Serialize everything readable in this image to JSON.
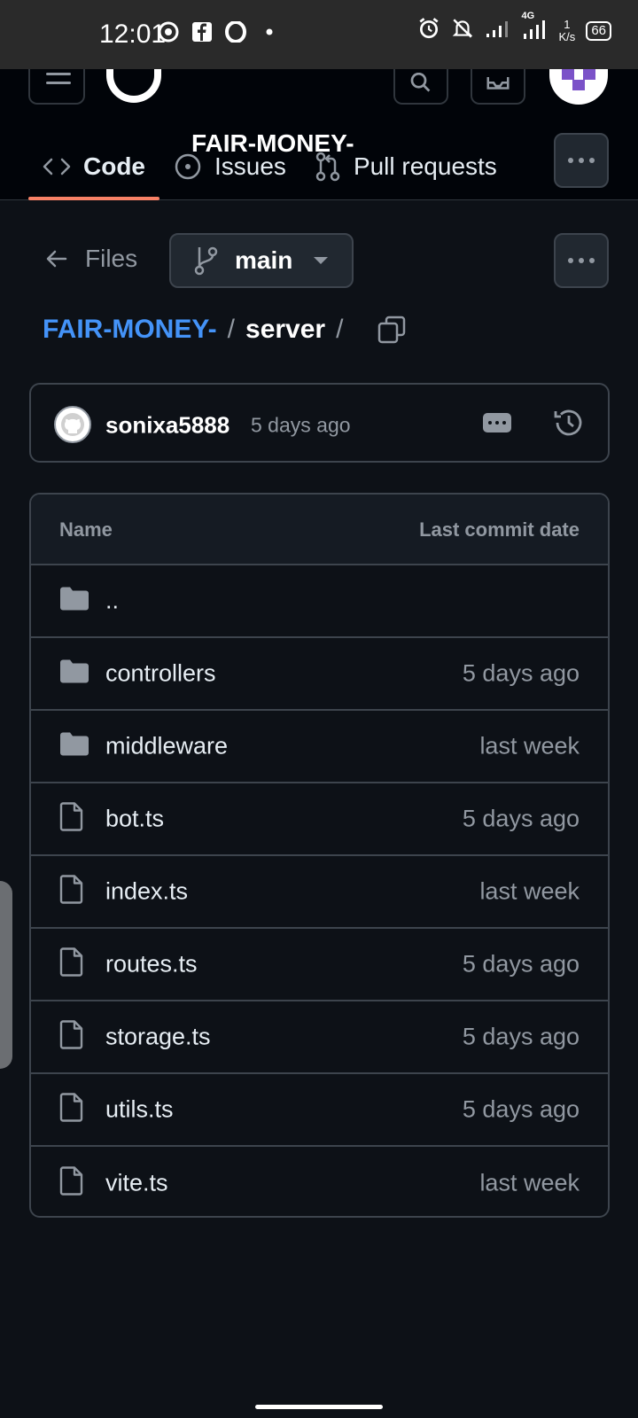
{
  "status_bar": {
    "time": "12:01",
    "network_type": "4G",
    "net_speed_value": "1",
    "net_speed_unit": "K/s",
    "battery": "66"
  },
  "header": {
    "repo_name": "FAIR-MONEY-"
  },
  "tabs": [
    {
      "label": "Code",
      "icon": "code-icon",
      "active": true
    },
    {
      "label": "Issues",
      "icon": "issue-icon",
      "active": false
    },
    {
      "label": "Pull requests",
      "icon": "pull-request-icon",
      "active": false
    }
  ],
  "files_nav": {
    "files_label": "Files",
    "branch": "main"
  },
  "breadcrumb": {
    "repo": "FAIR-MONEY-",
    "separator": "/",
    "current": "server"
  },
  "commit": {
    "user": "sonixa5888",
    "time": "5 days ago"
  },
  "table": {
    "col_name": "Name",
    "col_date": "Last commit date",
    "rows": [
      {
        "name": "..",
        "date": "",
        "type": "folder"
      },
      {
        "name": "controllers",
        "date": "5 days ago",
        "type": "folder"
      },
      {
        "name": "middleware",
        "date": "last week",
        "type": "folder"
      },
      {
        "name": "bot.ts",
        "date": "5 days ago",
        "type": "file"
      },
      {
        "name": "index.ts",
        "date": "last week",
        "type": "file"
      },
      {
        "name": "routes.ts",
        "date": "5 days ago",
        "type": "file"
      },
      {
        "name": "storage.ts",
        "date": "5 days ago",
        "type": "file"
      },
      {
        "name": "utils.ts",
        "date": "5 days ago",
        "type": "file"
      },
      {
        "name": "vite.ts",
        "date": "last week",
        "type": "file"
      }
    ]
  },
  "colors": {
    "background": "#0d1117",
    "link": "#4493f8",
    "active_tab_underline": "#f78166",
    "muted": "#9198a1"
  }
}
